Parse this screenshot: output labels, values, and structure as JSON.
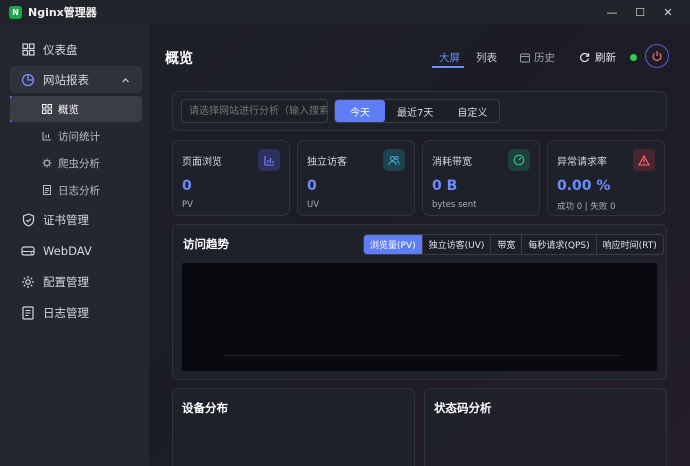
{
  "app": {
    "title": "Nginx管理器",
    "logo_letter": "N"
  },
  "window_controls": {
    "minimize": "—",
    "maximize": "☐",
    "close": "✕"
  },
  "sidebar": {
    "items": [
      {
        "label": "仪表盘"
      },
      {
        "label": "网站报表"
      },
      {
        "label": "证书管理"
      },
      {
        "label": "WebDAV"
      },
      {
        "label": "配置管理"
      },
      {
        "label": "日志管理"
      }
    ],
    "sub_items": [
      {
        "label": "概览"
      },
      {
        "label": "访问统计"
      },
      {
        "label": "爬虫分析"
      },
      {
        "label": "日志分析"
      }
    ]
  },
  "header": {
    "title": "概览",
    "view_tabs": [
      "大屏",
      "列表",
      "历史"
    ],
    "active_view": "大屏",
    "refresh_label": "刷新",
    "status_color": "#2ecc59"
  },
  "filter": {
    "search_placeholder": "请选择网站进行分析（输入搜索）",
    "ranges": [
      "今天",
      "最近7天",
      "自定义"
    ],
    "active_range": "今天"
  },
  "kpis": [
    {
      "label": "页面浏览",
      "value": "0",
      "sub": "PV",
      "icon": "bar-chart-icon",
      "color": "#6c8cff"
    },
    {
      "label": "独立访客",
      "value": "0",
      "sub": "UV",
      "icon": "users-icon",
      "color": "#3fb6d6"
    },
    {
      "label": "消耗带宽",
      "value": "0 B",
      "sub": "bytes sent",
      "icon": "gauge-icon",
      "color": "#3ecf9a"
    },
    {
      "label": "异常请求率",
      "value": "0.00 %",
      "sub": "成功 0 | 失败 0",
      "icon": "warning-icon",
      "color": "#ff6d6d"
    }
  ],
  "trend": {
    "title": "访问趋势",
    "tabs": [
      "浏览量(PV)",
      "独立访客(UV)",
      "带宽",
      "每秒请求(QPS)",
      "响应时间(RT)"
    ],
    "active_tab": "浏览量(PV)"
  },
  "bottom_panels": [
    {
      "title": "设备分布"
    },
    {
      "title": "状态码分析"
    }
  ]
}
